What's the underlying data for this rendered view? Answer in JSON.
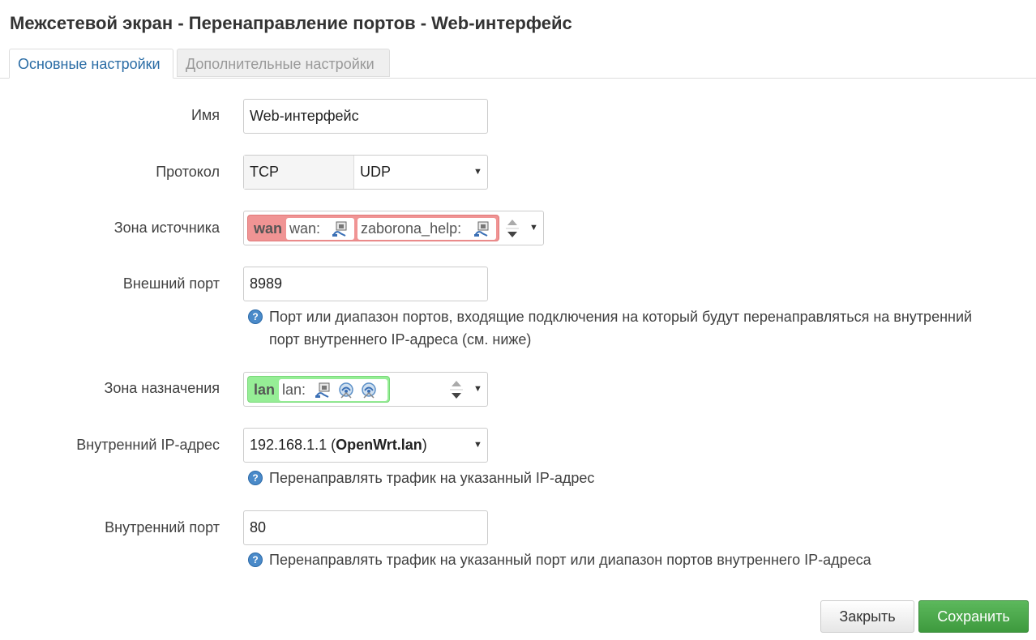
{
  "header": {
    "title": "Межсетевой экран - Перенаправление портов - Web-интерфейс"
  },
  "tabs": [
    {
      "label": "Основные настройки",
      "active": true
    },
    {
      "label": "Дополнительные настройки",
      "active": false
    }
  ],
  "form": {
    "name": {
      "label": "Имя",
      "value": "Web-интерфейс"
    },
    "protocol": {
      "label": "Протокол",
      "options": [
        "TCP",
        "UDP"
      ]
    },
    "source_zone": {
      "label": "Зона источника",
      "zone": "wan",
      "networks": [
        "wan:",
        "zaborona_help:"
      ],
      "color": "#f09090"
    },
    "external_port": {
      "label": "Внешний порт",
      "value": "8989",
      "help_line1": "Порт или диапазон портов, входящие подключения на который будут перенаправляться на внутренний",
      "help_line2": "порт внутреннего IP-адреса (см. ниже)"
    },
    "dest_zone": {
      "label": "Зона назначения",
      "zone": "lan",
      "networks": [
        "lan:"
      ],
      "color": "#90ee90"
    },
    "internal_ip": {
      "label": "Внутренний IP-адрес",
      "value_ip": "192.168.1.1 (",
      "value_host": "OpenWrt.lan",
      "value_close": ")",
      "help": "Перенаправлять трафик на указанный IP-адрес"
    },
    "internal_port": {
      "label": "Внутренний порт",
      "value": "80",
      "help": "Перенаправлять трафик на указанный порт или диапазон портов внутреннего IP-адреса"
    }
  },
  "buttons": {
    "close": "Закрыть",
    "save": "Сохранить"
  },
  "colors": {
    "accent": "#2a6ca5",
    "save": "#4cae4c",
    "help_icon": "#4a8ac9"
  }
}
